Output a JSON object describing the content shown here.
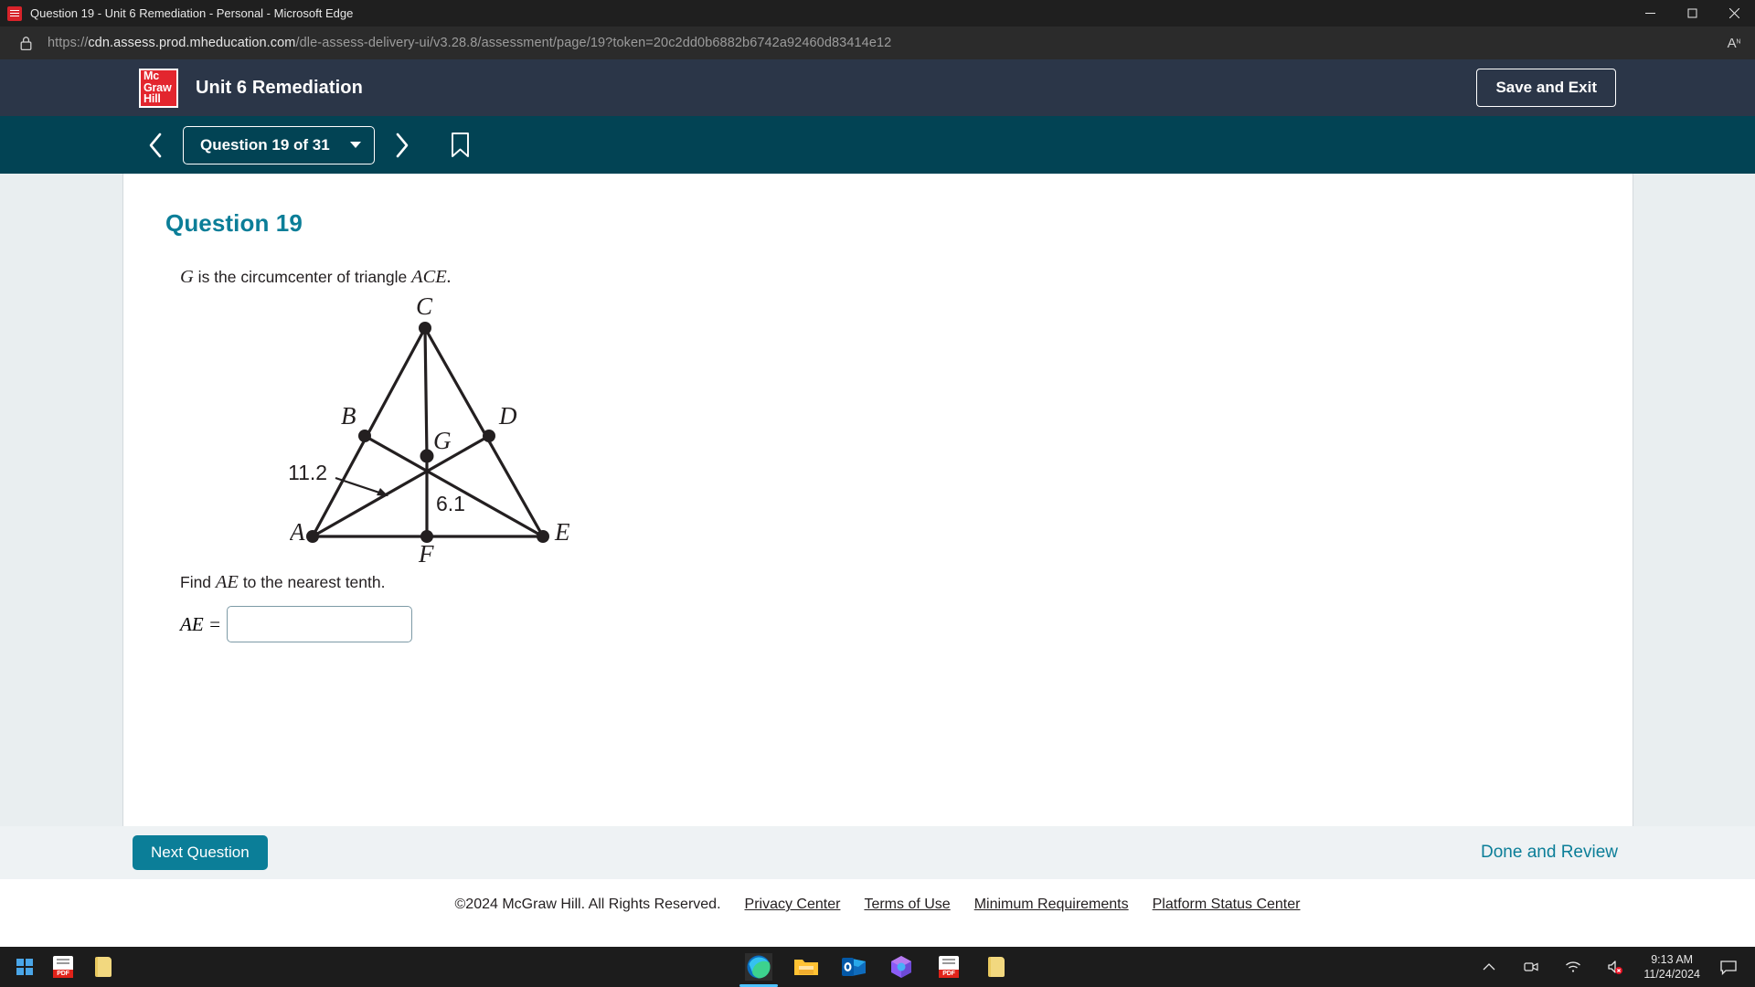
{
  "window": {
    "title": "Question 19 - Unit 6 Remediation - Personal - Microsoft Edge",
    "minimize_label": "Minimize",
    "restore_label": "Restore",
    "close_label": "Close"
  },
  "browser": {
    "url_protocol": "https://",
    "url_domain": "cdn.assess.prod.mheducation.com",
    "url_path": "/dle-assess-delivery-ui/v3.28.8/assessment/page/19?token=20c2dd0b6882b6742a92460d83414e12",
    "lock_icon": "lock-icon",
    "read_aloud_icon": "read-aloud-icon"
  },
  "header": {
    "logo_line1": "Mc",
    "logo_line2": "Graw",
    "logo_line3": "Hill",
    "title": "Unit 6 Remediation",
    "save_exit_label": "Save and Exit",
    "bg_color": "#2b3648",
    "logo_color": "#e3262e"
  },
  "navbar": {
    "prev_icon": "chevron-left-icon",
    "next_icon": "chevron-right-icon",
    "question_selector_label": "Question 19 of 31",
    "dropdown_icon": "chevron-down-icon",
    "bookmark_icon": "bookmark-icon",
    "bg_color": "#024354"
  },
  "question": {
    "heading": "Question 19",
    "heading_color": "#0b7e98",
    "prompt_before": "",
    "prompt_var": "G",
    "prompt_middle": " is the circumcenter of triangle ",
    "prompt_triangle": "ACE",
    "prompt_end": ".",
    "find_text_before": "Find ",
    "find_var": "AE",
    "find_text_after": " to the nearest tenth.",
    "answer_label": "AE =",
    "answer_value": "",
    "answer_placeholder": ""
  },
  "figure": {
    "labels": {
      "A": "A",
      "B": "B",
      "C": "C",
      "D": "D",
      "E": "E",
      "F": "F",
      "G": "G"
    },
    "measure_ag": "11.2",
    "measure_gf": "6.1"
  },
  "footer": {
    "next_question_label": "Next Question",
    "done_review_label": "Done and Review",
    "copyright": "©2024 McGraw Hill. All Rights Reserved.",
    "links": [
      "Privacy Center",
      "Terms of Use",
      "Minimum Requirements",
      "Platform Status Center"
    ],
    "accent_color": "#0b7e98"
  },
  "taskbar": {
    "start_icon": "windows-start-icon",
    "pinned": [
      {
        "name": "pdf-icon",
        "label": "PDF"
      },
      {
        "name": "folder-icon",
        "label": "Folder"
      }
    ],
    "apps": [
      {
        "name": "edge-icon",
        "label": "Microsoft Edge",
        "active": true
      },
      {
        "name": "file-explorer-icon",
        "label": "File Explorer",
        "active": false
      },
      {
        "name": "outlook-icon",
        "label": "Outlook",
        "active": false
      },
      {
        "name": "microsoft-365-icon",
        "label": "Microsoft 365",
        "active": false
      },
      {
        "name": "pdf-icon",
        "label": "PDF",
        "active": false
      },
      {
        "name": "folder-icon",
        "label": "Folder",
        "active": false
      }
    ],
    "tray": {
      "overflow_icon": "chevron-up-icon",
      "meeting_icon": "camera-icon",
      "network_icon": "wifi-icon",
      "volume_icon": "volume-muted-icon",
      "time": "9:13 AM",
      "date": "11/24/2024",
      "notification_icon": "notification-icon"
    }
  }
}
